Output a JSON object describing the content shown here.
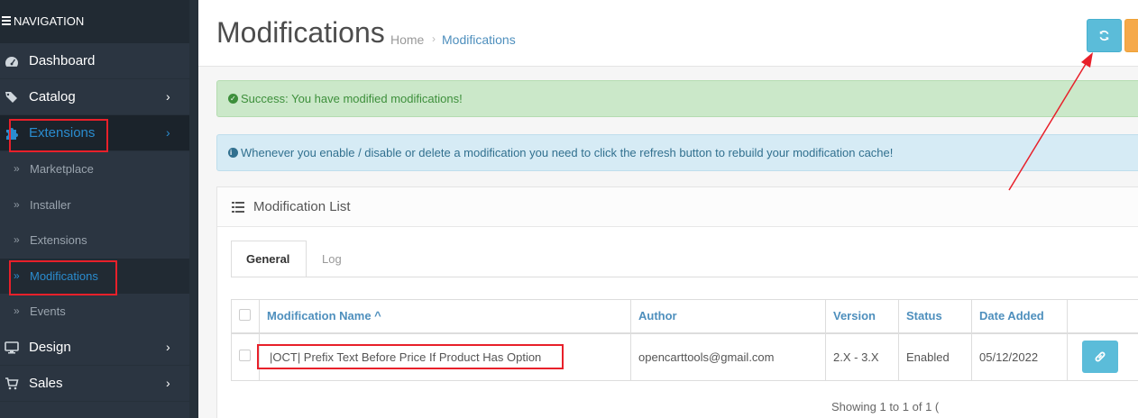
{
  "sidebar": {
    "heading": "NAVIGATION",
    "items": [
      {
        "label": "Dashboard",
        "icon": "dashboard-icon"
      },
      {
        "label": "Catalog",
        "icon": "tags-icon",
        "chevron": "›"
      },
      {
        "label": "Extensions",
        "icon": "puzzle-icon",
        "chevron": "›"
      }
    ],
    "sub_items": [
      {
        "label": "Marketplace"
      },
      {
        "label": "Installer"
      },
      {
        "label": "Extensions"
      },
      {
        "label": "Modifications"
      },
      {
        "label": "Events"
      }
    ],
    "items_after": [
      {
        "label": "Design",
        "icon": "desktop-icon",
        "chevron": "›"
      },
      {
        "label": "Sales",
        "icon": "cart-icon",
        "chevron": "›"
      }
    ],
    "sub_marker": "»"
  },
  "header": {
    "title": "Modifications",
    "breadcrumb_home": "Home",
    "breadcrumb_sep": "›",
    "breadcrumb_current": "Modifications"
  },
  "alerts": {
    "success": "Success: You have modified modifications!",
    "info": "Whenever you enable / disable or delete a modification you need to click the refresh button to rebuild your modification cache!"
  },
  "panel": {
    "title": "Modification List",
    "tabs": [
      "General",
      "Log"
    ]
  },
  "table": {
    "headers": [
      "Modification Name ^",
      "Author",
      "Version",
      "Status",
      "Date Added"
    ],
    "rows": [
      {
        "name": "|OCT| Prefix Text Before Price If Product Has Option",
        "author": "opencarttools@gmail.com",
        "version": "2.X - 3.X",
        "status": "Enabled",
        "date_added": "05/12/2022"
      }
    ]
  },
  "pagination": {
    "text": "Showing 1 to 1 of 1 ("
  },
  "colors": {
    "accent": "#2a8ccf",
    "refresh_button": "#5bbcd9",
    "annotation": "#e8202a"
  }
}
